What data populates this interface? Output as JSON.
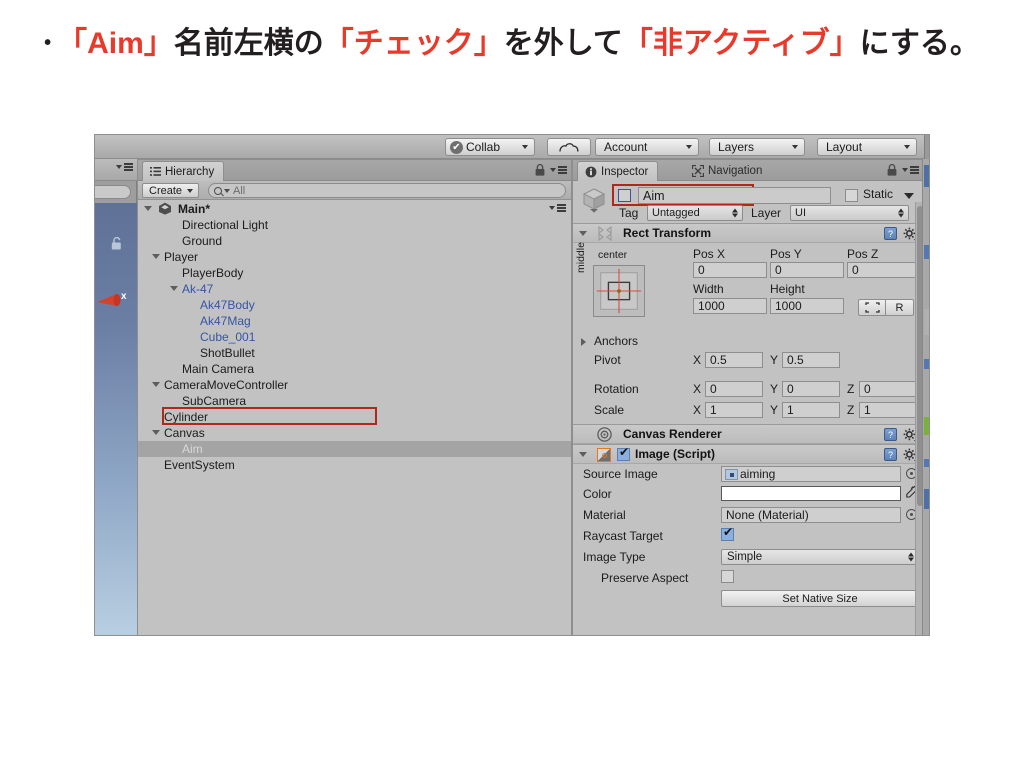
{
  "slide": {
    "bullet": "•",
    "segments": [
      {
        "text": "「Aim」",
        "highlight": true
      },
      {
        "text": "名前左横の",
        "highlight": false
      },
      {
        "text": "「チェック」",
        "highlight": true
      },
      {
        "text": "を外して",
        "highlight": false
      },
      {
        "text": "「非アクティブ」",
        "highlight": true
      },
      {
        "text": "にする。",
        "highlight": false
      }
    ],
    "full_text": "•「Aim」名前左横の「チェック」を外して「非アクティブ」にする。",
    "highlight_color": "#e8392a",
    "text_color": "#231f20"
  },
  "toolbar": {
    "collab_label": "Collab",
    "collab_icon": "check-circle-icon",
    "cloud_icon": "cloud-icon",
    "account_label": "Account",
    "layers_label": "Layers",
    "layout_label": "Layout"
  },
  "scene_sliver": {
    "lock_icon": "unlocked-padlock-icon",
    "gizmo_axis_label": "x",
    "gizmo_color": "#d6412b",
    "sky_top": "#5f7196",
    "sky_bottom": "#b9cfe2"
  },
  "hierarchy": {
    "tab_label": "Hierarchy",
    "tab_icon": "hierarchy-icon",
    "lock_icon": "padlock-icon",
    "menu_icon": "hamburger-menu-icon",
    "create_label": "Create",
    "search_value": "All",
    "search_icon": "search-icon",
    "scene_name": "Main*",
    "scene_icon": "unity-logo-icon",
    "items": [
      {
        "label": "Directional Light",
        "indent": 2,
        "arrow": "none",
        "prefab": false,
        "selected": false
      },
      {
        "label": "Ground",
        "indent": 2,
        "arrow": "none",
        "prefab": false,
        "selected": false
      },
      {
        "label": "Player",
        "indent": 1,
        "arrow": "open",
        "prefab": false,
        "selected": false
      },
      {
        "label": "PlayerBody",
        "indent": 2,
        "arrow": "none",
        "prefab": false,
        "selected": false
      },
      {
        "label": "Ak-47",
        "indent": 2,
        "arrow": "open",
        "prefab": true,
        "selected": false
      },
      {
        "label": "Ak47Body",
        "indent": 3,
        "arrow": "none",
        "prefab": true,
        "selected": false
      },
      {
        "label": "Ak47Mag",
        "indent": 3,
        "arrow": "none",
        "prefab": true,
        "selected": false
      },
      {
        "label": "Cube_001",
        "indent": 3,
        "arrow": "none",
        "prefab": true,
        "selected": false
      },
      {
        "label": "ShotBullet",
        "indent": 3,
        "arrow": "none",
        "prefab": false,
        "selected": false
      },
      {
        "label": "Main Camera",
        "indent": 2,
        "arrow": "none",
        "prefab": false,
        "selected": false
      },
      {
        "label": "CameraMoveController",
        "indent": 1,
        "arrow": "open",
        "prefab": false,
        "selected": false
      },
      {
        "label": "SubCamera",
        "indent": 2,
        "arrow": "none",
        "prefab": false,
        "selected": false
      },
      {
        "label": "Cylinder",
        "indent": 1,
        "arrow": "none",
        "prefab": false,
        "selected": false
      },
      {
        "label": "Canvas",
        "indent": 1,
        "arrow": "open",
        "prefab": false,
        "selected": false
      },
      {
        "label": "Aim",
        "indent": 2,
        "arrow": "none",
        "prefab": false,
        "selected": true
      },
      {
        "label": "EventSystem",
        "indent": 1,
        "arrow": "none",
        "prefab": false,
        "selected": false
      }
    ],
    "annotation_target": "Aim",
    "annotation_color": "#b0281a"
  },
  "inspector": {
    "tabs": [
      {
        "label": "Inspector",
        "icon": "info-circle-icon",
        "active": true
      },
      {
        "label": "Navigation",
        "icon": "navigation-icon",
        "active": false
      }
    ],
    "lock_icon": "padlock-icon",
    "menu_icon": "hamburger-menu-icon",
    "object": {
      "enabled_checkbox_checked": false,
      "name": "Aim",
      "static_label": "Static",
      "static_checked": false,
      "tag_label": "Tag",
      "tag_value": "Untagged",
      "layer_label": "Layer",
      "layer_value": "UI",
      "icon": "gameobject-cube-icon",
      "annotation_color": "#b0281a"
    },
    "rect_transform": {
      "title": "Rect Transform",
      "icon": "rect-transform-icon",
      "help_icon": "help-book-icon",
      "gear_icon": "gear-icon",
      "anchor_preset_top_label": "center",
      "anchor_preset_side_label": "middle",
      "pos_x_label": "Pos X",
      "pos_x": "0",
      "pos_y_label": "Pos Y",
      "pos_y": "0",
      "pos_z_label": "Pos Z",
      "pos_z": "0",
      "width_label": "Width",
      "width": "1000",
      "height_label": "Height",
      "height": "1000",
      "blueprint_icon": "blueprint-mode-icon",
      "rawedit_label": "R",
      "anchors_label": "Anchors",
      "pivot_label": "Pivot",
      "pivot_x": "0.5",
      "pivot_y": "0.5",
      "rotation_label": "Rotation",
      "rotation_x": "0",
      "rotation_y": "0",
      "rotation_z": "0",
      "scale_label": "Scale",
      "scale_x": "1",
      "scale_y": "1",
      "scale_z": "1",
      "axis_x": "X",
      "axis_y": "Y",
      "axis_z": "Z"
    },
    "canvas_renderer": {
      "title": "Canvas Renderer",
      "icon": "canvas-renderer-icon",
      "help_icon": "help-book-icon",
      "gear_icon": "gear-icon"
    },
    "image_script": {
      "title": "Image (Script)",
      "icon": "image-script-icon",
      "enabled_checked": true,
      "help_icon": "help-book-icon",
      "gear_icon": "gear-icon",
      "source_image_label": "Source Image",
      "source_image_value": "aiming",
      "source_image_chip": "sprite-thumbnail-icon",
      "color_label": "Color",
      "color_value": "#ffffff",
      "eyedropper_icon": "eyedropper-icon",
      "material_label": "Material",
      "material_value": "None (Material)",
      "raycast_label": "Raycast Target",
      "raycast_checked": true,
      "image_type_label": "Image Type",
      "image_type_value": "Simple",
      "preserve_aspect_label": "Preserve Aspect",
      "preserve_aspect_checked": false,
      "set_native_size_label": "Set Native Size",
      "object_picker_icon": "object-picker-icon"
    }
  }
}
